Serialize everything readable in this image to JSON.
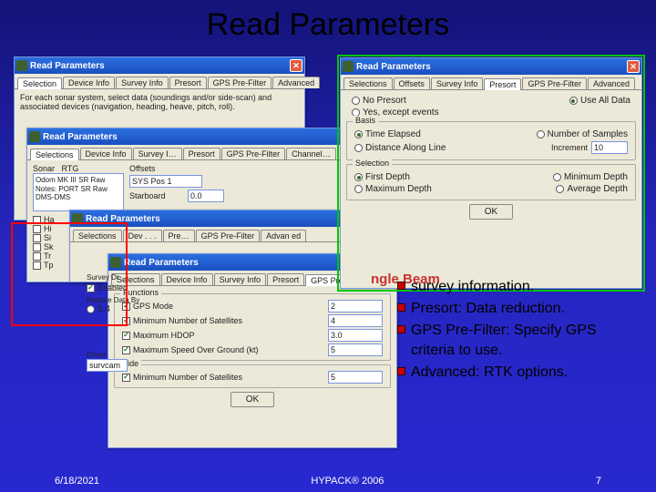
{
  "slide": {
    "title": "Read Parameters",
    "date": "6/18/2021",
    "product": "HYPACK® 2006",
    "page": "7"
  },
  "bullets": {
    "sb_label": "ngle Beam",
    "items": [
      "survey information.",
      "Presort: Data reduction.",
      "GPS Pre-Filter: Specify GPS criteria to use.",
      "Advanced: RTK options."
    ]
  },
  "win_back": {
    "title": "Read Parameters",
    "tabs": [
      "Selection",
      "Device Info",
      "Survey Info",
      "Presort",
      "GPS Pre-Filter",
      "Advanced"
    ],
    "helptext": "For each sonar system, select data (soundings and/or side-scan) and associated devices (navigation, heading, heave, pitch, roll)."
  },
  "win_mid_a": {
    "title": "Read Parameters",
    "tabs": [
      "Selections",
      "Device Info",
      "Survey I…",
      "Presort",
      "GPS Pre-Filter",
      "Channel…"
    ],
    "list_label": "Sonar   RTG",
    "list_items": [
      "Odom MK III SR Raw",
      "Notes: PORT SR Raw",
      "DMS-DMS"
    ],
    "left_checks": [
      "Ha",
      "Hi",
      "Si",
      "Sk",
      "Tr",
      "Tp"
    ],
    "offs_label": "Offsets",
    "offs_col1": "SYS Pos 1",
    "offs_col2": "Starboard",
    "offs_val": "0.0"
  },
  "win_mid_b": {
    "title": "Read Parameters",
    "tabs": [
      "Selections",
      "Dev . . .",
      "Pre…",
      "GPS Pre-Filter",
      "Advan ed"
    ]
  },
  "win_devinfo": {
    "title": "Read Parameters",
    "sidebar": {
      "enabled_lbl": "Enabled",
      "enabled": true,
      "reduce_lbl": "Reduce Data By",
      "reduce": false,
      "reduce_val": "5.4",
      "driver_lbl": "Driver",
      "driver": "survcam"
    },
    "tabs": [
      "Selections",
      "Device Info",
      "Survey Info",
      "Presort",
      "GPS Pre-Filter",
      "Advanced"
    ],
    "functions_label": "Functions",
    "functions": [
      {
        "lbl": "GPS Mode",
        "on": true,
        "val": "2"
      },
      {
        "lbl": "Minimum Number of Satellites",
        "on": true,
        "val": "4"
      },
      {
        "lbl": "Maximum HDOP",
        "on": true,
        "val": "3.0"
      },
      {
        "lbl": "Maximum Speed Over Ground (kt)",
        "on": true,
        "val": "5"
      }
    ],
    "tide_lbl": "Tide",
    "tide_items": [
      {
        "lbl": "Minimum Number of Satellites",
        "on": true,
        "val": "5"
      }
    ],
    "ok": "OK"
  },
  "win_presort": {
    "title": "Read Parameters",
    "tabs": [
      "Selections",
      "Offsets",
      "Survey Info",
      "Presort",
      "GPS Pre-Filter",
      "Advanced"
    ],
    "top": {
      "no_presort": "No Presort",
      "yes_events": "Yes, except events",
      "use_all": "Use All Data"
    },
    "basis": {
      "label": "Basis",
      "time": "Time Elapsed",
      "num": "Number of Samples",
      "dist": "Distance Along Line",
      "incr_lbl": "Increment",
      "incr_val": "10"
    },
    "sel": {
      "label": "Selection",
      "first": "First Depth",
      "min": "Minimum Depth",
      "max": "Maximum Depth",
      "avg": "Average Depth"
    },
    "ok": "OK"
  },
  "chart_data": null
}
